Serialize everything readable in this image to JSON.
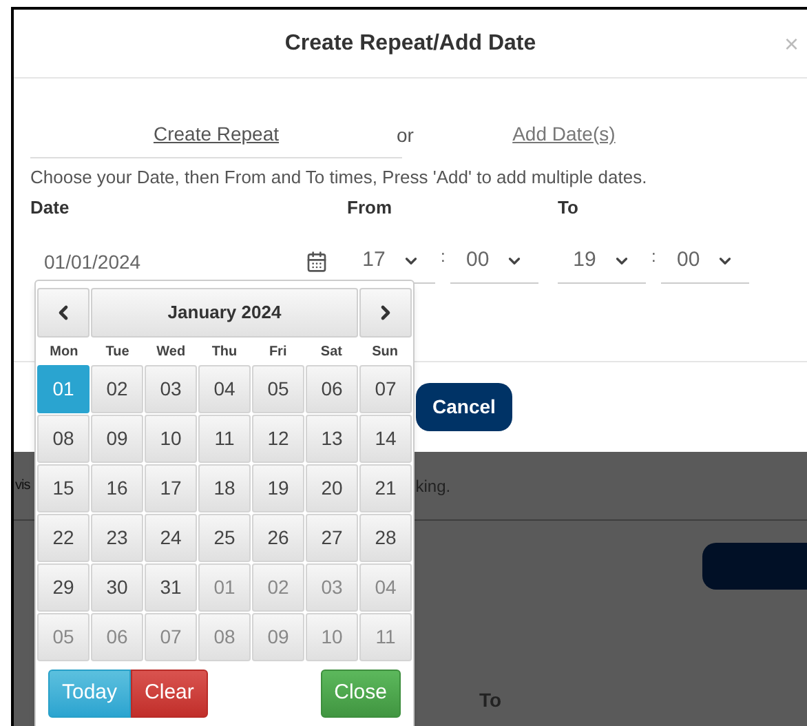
{
  "dialog": {
    "title": "Create Repeat/Add Date",
    "close": "×",
    "links": [
      {
        "label": "Create Repeat",
        "selected": true
      },
      {
        "label": "Add Date(s)",
        "selected": false
      }
    ],
    "separator": "or",
    "instructions": "Choose your Date, then From and To times, Press 'Add' to add multiple dates.",
    "labels": [
      "Date",
      "From",
      "To"
    ],
    "date_value": "01/01/2024",
    "from": {
      "hour": "17",
      "separator": ":",
      "minute": "00"
    },
    "to": {
      "hour": "19",
      "separator": ":",
      "minute": "00"
    },
    "cancel_button": "Cancel"
  },
  "datepicker": {
    "title": "January 2024",
    "weekdays": [
      "Mon",
      "Tue",
      "Wed",
      "Thu",
      "Fri",
      "Sat",
      "Sun"
    ],
    "days": [
      {
        "label": "01",
        "selected": true,
        "muted": false
      },
      {
        "label": "02",
        "selected": false,
        "muted": false
      },
      {
        "label": "03",
        "selected": false,
        "muted": false
      },
      {
        "label": "04",
        "selected": false,
        "muted": false
      },
      {
        "label": "05",
        "selected": false,
        "muted": false
      },
      {
        "label": "06",
        "selected": false,
        "muted": false
      },
      {
        "label": "07",
        "selected": false,
        "muted": false
      },
      {
        "label": "08",
        "selected": false,
        "muted": false
      },
      {
        "label": "09",
        "selected": false,
        "muted": false
      },
      {
        "label": "10",
        "selected": false,
        "muted": false
      },
      {
        "label": "11",
        "selected": false,
        "muted": false
      },
      {
        "label": "12",
        "selected": false,
        "muted": false
      },
      {
        "label": "13",
        "selected": false,
        "muted": false
      },
      {
        "label": "14",
        "selected": false,
        "muted": false
      },
      {
        "label": "15",
        "selected": false,
        "muted": false
      },
      {
        "label": "16",
        "selected": false,
        "muted": false
      },
      {
        "label": "17",
        "selected": false,
        "muted": false
      },
      {
        "label": "18",
        "selected": false,
        "muted": false
      },
      {
        "label": "19",
        "selected": false,
        "muted": false
      },
      {
        "label": "20",
        "selected": false,
        "muted": false
      },
      {
        "label": "21",
        "selected": false,
        "muted": false
      },
      {
        "label": "22",
        "selected": false,
        "muted": false
      },
      {
        "label": "23",
        "selected": false,
        "muted": false
      },
      {
        "label": "24",
        "selected": false,
        "muted": false
      },
      {
        "label": "25",
        "selected": false,
        "muted": false
      },
      {
        "label": "26",
        "selected": false,
        "muted": false
      },
      {
        "label": "27",
        "selected": false,
        "muted": false
      },
      {
        "label": "28",
        "selected": false,
        "muted": false
      },
      {
        "label": "29",
        "selected": false,
        "muted": false
      },
      {
        "label": "30",
        "selected": false,
        "muted": false
      },
      {
        "label": "31",
        "selected": false,
        "muted": false
      },
      {
        "label": "01",
        "selected": false,
        "muted": true
      },
      {
        "label": "02",
        "selected": false,
        "muted": true
      },
      {
        "label": "03",
        "selected": false,
        "muted": true
      },
      {
        "label": "04",
        "selected": false,
        "muted": true
      },
      {
        "label": "05",
        "selected": false,
        "muted": true
      },
      {
        "label": "06",
        "selected": false,
        "muted": true
      },
      {
        "label": "07",
        "selected": false,
        "muted": true
      },
      {
        "label": "08",
        "selected": false,
        "muted": true
      },
      {
        "label": "09",
        "selected": false,
        "muted": true
      },
      {
        "label": "10",
        "selected": false,
        "muted": true
      },
      {
        "label": "11",
        "selected": false,
        "muted": true
      }
    ],
    "buttons": [
      {
        "label": "Today",
        "kind": "info"
      },
      {
        "label": "Clear",
        "kind": "danger"
      },
      {
        "label": "Close",
        "kind": "success"
      }
    ]
  },
  "background": {
    "text_fragments": [
      "vis",
      "king."
    ],
    "label": "To"
  }
}
